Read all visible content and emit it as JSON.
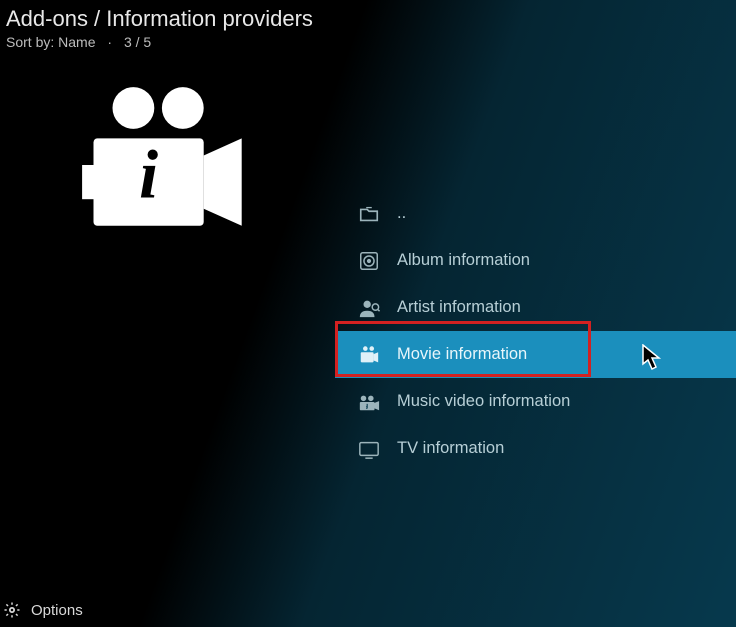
{
  "header": {
    "title": "Add-ons / Information providers",
    "sort_label": "Sort by: Name",
    "position": "3 / 5"
  },
  "items": [
    {
      "label": "..",
      "icon": "folder-icon",
      "selected": false
    },
    {
      "label": "Album information",
      "icon": "album-icon",
      "selected": false
    },
    {
      "label": "Artist information",
      "icon": "artist-icon",
      "selected": false
    },
    {
      "label": "Movie information",
      "icon": "movie-icon",
      "selected": true
    },
    {
      "label": "Music video information",
      "icon": "music-video-icon",
      "selected": false
    },
    {
      "label": "TV information",
      "icon": "tv-icon",
      "selected": false
    }
  ],
  "footer": {
    "options_label": "Options"
  }
}
